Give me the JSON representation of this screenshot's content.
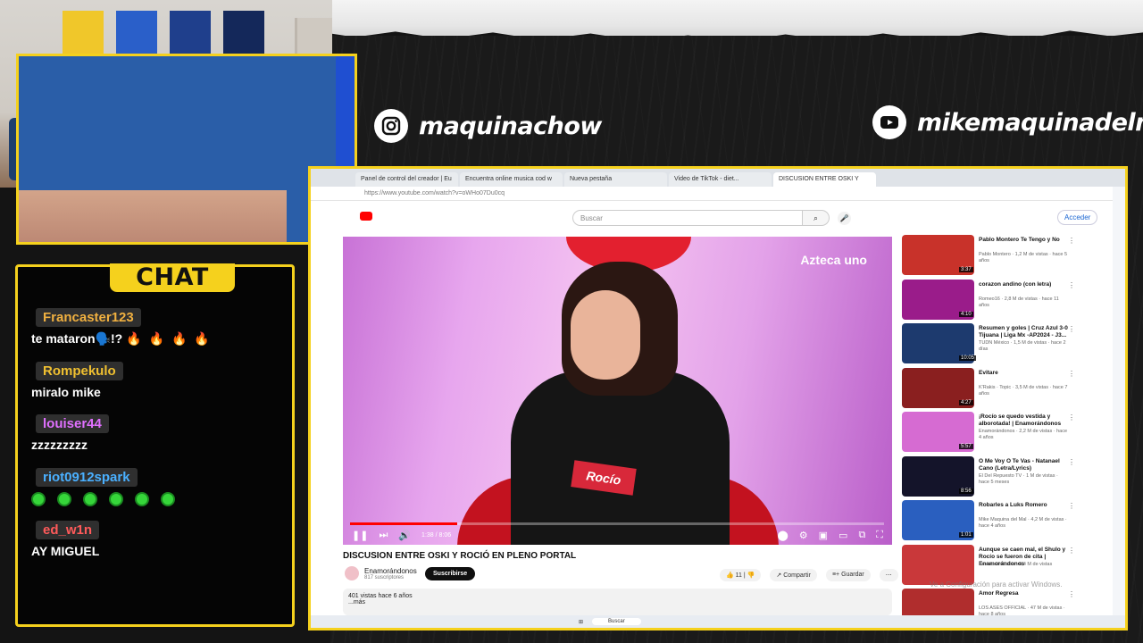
{
  "socials": {
    "instagram": "maquinachow",
    "youtube": "mikemaquinadelmal"
  },
  "chat": {
    "title": "CHAT",
    "messages": [
      {
        "user": "Francaster123",
        "color": "#f0b040",
        "text": "te mataron🗣️!?"
      },
      {
        "user": "Rompekulo",
        "color": "#f0c030",
        "text": "miralo mike"
      },
      {
        "user": "louiser44",
        "color": "#e070ff",
        "text": "zzzzzzzzz"
      },
      {
        "user": "riot0912spark",
        "color": "#4ab0ff",
        "text": ""
      },
      {
        "user": "ed_w1n",
        "color": "#ff5a5a",
        "text": "AY MIGUEL"
      }
    ]
  },
  "browser": {
    "tabs": [
      "Panel de control del creador | Eu",
      "Encuentra online musica cod w",
      "Nueva pestaña",
      "Video de TikTok - diet...",
      "DISCUSION ENTRE OSKI Y"
    ],
    "url": "https://www.youtube.com/watch?v=oWHo07Du0cq",
    "search_placeholder": "Buscar",
    "signin": "Acceder",
    "taskbar_search": "Buscar"
  },
  "video": {
    "title": "DISCUSION ENTRE OSKI Y ROCIÓ EN PLENO PORTAL",
    "channel": "Enamorándonos",
    "subscribers": "817 suscriptores",
    "subscribe_label": "Suscribirse",
    "likes": "11",
    "share": "Compartir",
    "save": "Guardar",
    "views": "401 vistas  hace 6 años",
    "more": "...más",
    "time": "1:38 / 8:06",
    "progress": 0.2,
    "brand": "Azteca uno",
    "name_tag": "Rocío"
  },
  "recommendations": [
    {
      "title": "Pablo Montero Te Tengo y No",
      "channel": "Pablo Montero",
      "meta": "1,2 M de vistas · hace 5 años",
      "duration": "3:37",
      "color": "#c8322a"
    },
    {
      "title": "corazon andino (con letra)",
      "channel": "Romeo16",
      "meta": "2,8 M de vistas · hace 11 años",
      "duration": "4:10",
      "color": "#9a1c8a"
    },
    {
      "title": "Resumen y goles | Cruz Azul 3-0 Tijuana | Liga Mx -AP2024 - J3...",
      "channel": "TUDN México",
      "meta": "1,5 M de vistas · hace 2 días",
      "duration": "10:05",
      "color": "#1d3a6e"
    },
    {
      "title": "Evitare",
      "channel": "K'Rakis · Topic",
      "meta": "3,5 M de vistas · hace 7 años",
      "duration": "4:27",
      "color": "#8a1f1f"
    },
    {
      "title": "¡Rocío se quedo vestida y alborotada! | Enamorándonos",
      "channel": "Enamorándonos",
      "meta": "2,2 M de vistas · hace 4 años",
      "duration": "5:57",
      "color": "#d66bd2"
    },
    {
      "title": "O Me Voy O Te Vas - Natanael Cano (Letra/Lyrics)",
      "channel": "El Del Repuesto TV",
      "meta": "1 M de vistas · hace 5 meses",
      "duration": "8:56",
      "color": "#14142a"
    },
    {
      "title": "Robarles a Luks Romero",
      "channel": "Mike Maquina del Mal",
      "meta": "4,2 M de vistas · hace 4 años",
      "duration": "1:01",
      "color": "#2a5fbf"
    },
    {
      "title": "Aunque se caen mal, el Shulo y Rocío se fueron de cita | Enamorándonos",
      "channel": "Enamorándonos",
      "meta": "6,4 M de vistas",
      "duration": "",
      "color": "#c9383a"
    },
    {
      "title": "Amor Regresa",
      "channel": "LOS ASES OFFICIAL",
      "meta": "47 M de vistas · hace 8 años",
      "duration": "",
      "color": "#b02d2d"
    }
  ],
  "watermark": "Ve a Configuración para activar Windows."
}
